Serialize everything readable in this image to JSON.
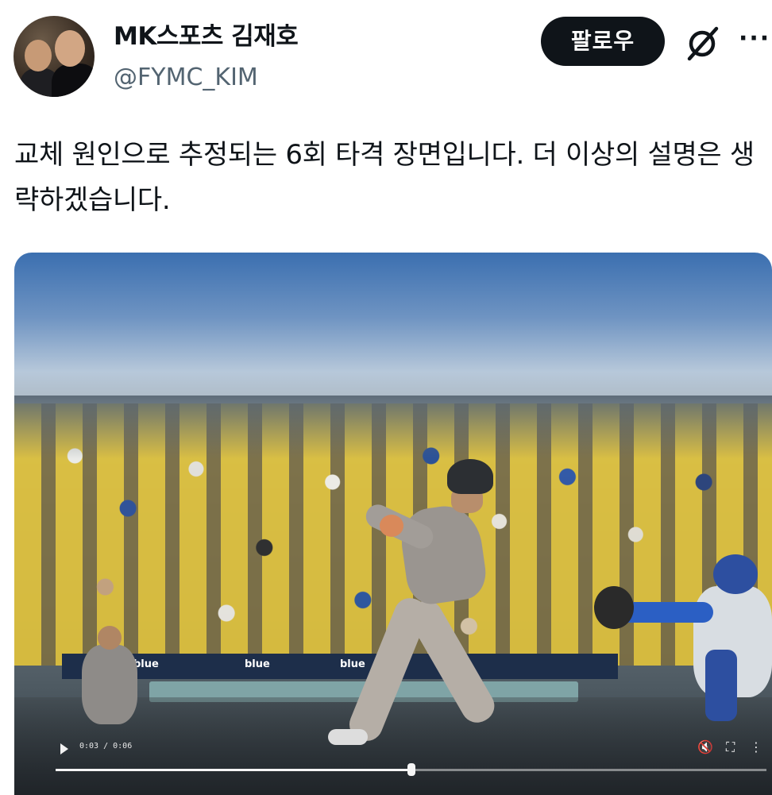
{
  "author": {
    "display_name": "MK스포츠 김재호",
    "handle": "@FYMC_KIM"
  },
  "actions": {
    "follow_label": "팔로우",
    "more_label": "···"
  },
  "tweet": {
    "text": "교체 원인으로 추정되는 6회 타격 장면입니다. 더 이상의 설명은 생략하겠습니다."
  },
  "video": {
    "time": "0:03 / 0:06",
    "progress": 0.5,
    "wall_ads": [
      "blue",
      "blue",
      "blue"
    ]
  },
  "colors": {
    "button_bg": "#0f1419",
    "handle": "#536471"
  }
}
